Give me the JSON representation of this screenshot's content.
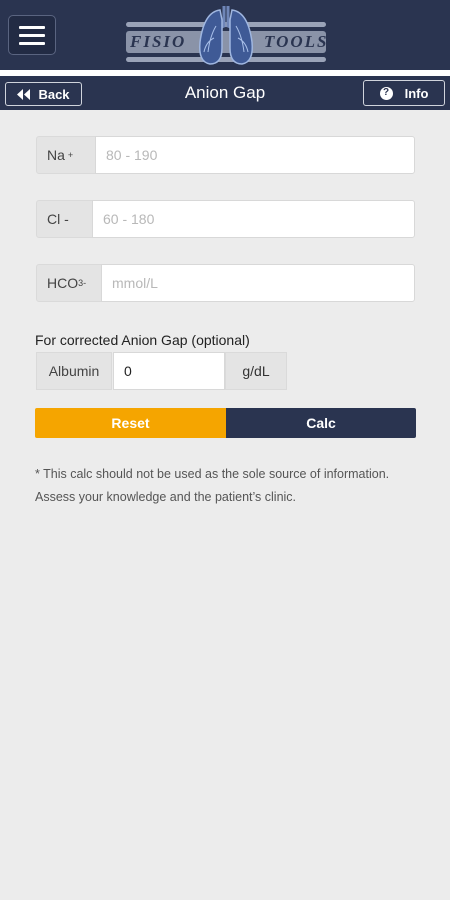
{
  "header": {
    "logo_left": "FISIO",
    "logo_right": "TOOLS",
    "menu_icon": "hamburger-menu-icon",
    "logo_icon": "lungs-icon"
  },
  "titlebar": {
    "back_label": "Back",
    "back_icon": "double-chevron-left-icon",
    "title": "Anion Gap",
    "info_label": "Info",
    "info_icon": "question-circle-icon"
  },
  "form": {
    "na": {
      "label": "Na",
      "label_sup": "+",
      "placeholder": "80 - 190",
      "value": ""
    },
    "cl": {
      "label": "Cl -",
      "placeholder": "60 - 180",
      "value": ""
    },
    "hco3": {
      "label": "HCO",
      "label_sub": "3",
      "label_sup": "-",
      "placeholder": "mmol/L",
      "value": ""
    },
    "optional_heading": "For corrected Anion Gap (optional)",
    "albumin": {
      "label": "Albumin",
      "value": "0",
      "unit": "g/dL"
    }
  },
  "actions": {
    "reset_label": "Reset",
    "calc_label": "Calc"
  },
  "disclaimer": "* This calc should not be used as the sole source of information. Assess your knowledge and the patient’s clinic.",
  "colors": {
    "navy": "#2a3450",
    "orange": "#f5a500",
    "background": "#ececec"
  }
}
